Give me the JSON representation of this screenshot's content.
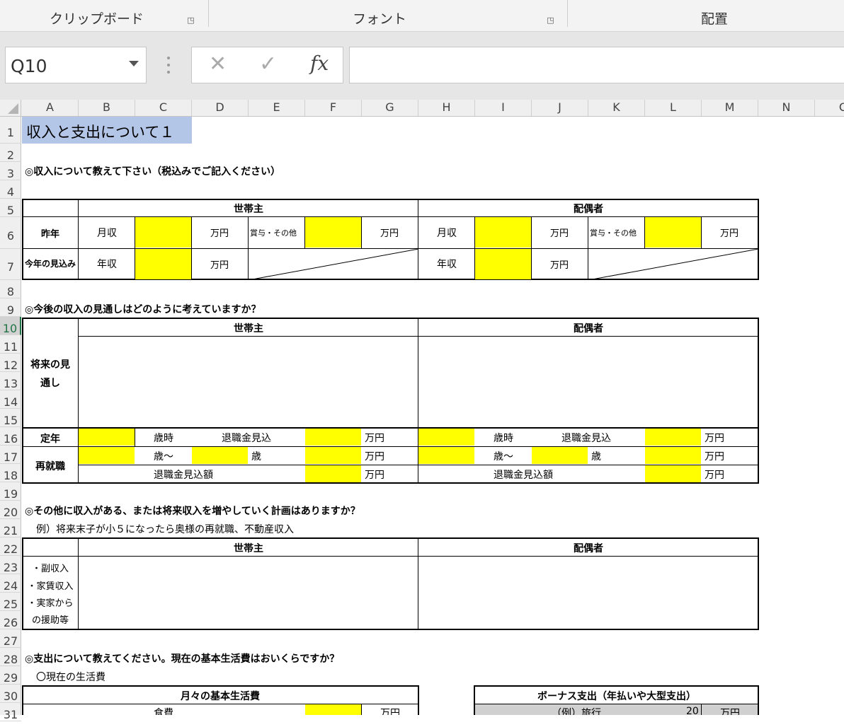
{
  "ribbon": {
    "groups": [
      "クリップボード",
      "フォント",
      "配置"
    ]
  },
  "formula_bar": {
    "name_box": "Q10",
    "cancel_glyph": "✕",
    "enter_glyph": "✓",
    "fx_label": "fx",
    "formula": ""
  },
  "sheet": {
    "columns": [
      "A",
      "B",
      "C",
      "D",
      "E",
      "F",
      "G",
      "H",
      "I",
      "J",
      "K",
      "L",
      "M",
      "N",
      "C"
    ],
    "rows": [
      "1",
      "2",
      "3",
      "4",
      "5",
      "6",
      "7",
      "8",
      "9",
      "10",
      "11",
      "12",
      "13",
      "14",
      "15",
      "16",
      "17",
      "18",
      "19",
      "20",
      "21",
      "22",
      "23",
      "24",
      "25",
      "26",
      "27",
      "28",
      "29",
      "30",
      "31"
    ],
    "selected_row": "10",
    "title": "収入と支出について１",
    "s1": {
      "heading": "◎収入について教えて下さい（税込みでご記入ください）",
      "householder": "世帯主",
      "spouse": "配偶者",
      "last_year": "昨年",
      "this_year": "今年の見込み",
      "monthly": "月収",
      "annual": "年収",
      "bonus": "賞与・その他",
      "unit": "万円"
    },
    "s2": {
      "heading": "◎今後の収入の見通しはどのように考えていますか？",
      "householder": "世帯主",
      "spouse": "配偶者",
      "outlook_1": "将来の見",
      "outlook_2": "通し",
      "retire": "定年",
      "rehire": "再就職",
      "age_at": "歳時",
      "severance": "退職金見込",
      "age_from": "歳～",
      "age": "歳",
      "severance_amount": "退職金見込額",
      "unit": "万円"
    },
    "s3": {
      "heading": "◎その他に収入がある、または将来収入を増やしていく計画はありますか？",
      "example": "例）将来末子が小５になったら奥様の再就職、不動産収入",
      "householder": "世帯主",
      "spouse": "配偶者",
      "items": [
        "・副収入",
        "・家賃収入",
        "・実家から",
        "の援助等"
      ]
    },
    "s4": {
      "heading": "◎支出について教えてください。現在の基本生活費はおいくらですか？",
      "sub": "〇現在の生活費",
      "monthly_title": "月々の基本生活費",
      "food": "食費",
      "unit": "万円",
      "bonus_title": "ボーナス支出（年払いや大型支出）",
      "example_label": "（例）旅行",
      "example_value": "20",
      "example_unit": "万円"
    }
  },
  "colors": {
    "input_fill": "#ffff00",
    "title_fill": "#b4c6e7",
    "example_fill": "#d0d0d0",
    "selection": "#217346"
  }
}
